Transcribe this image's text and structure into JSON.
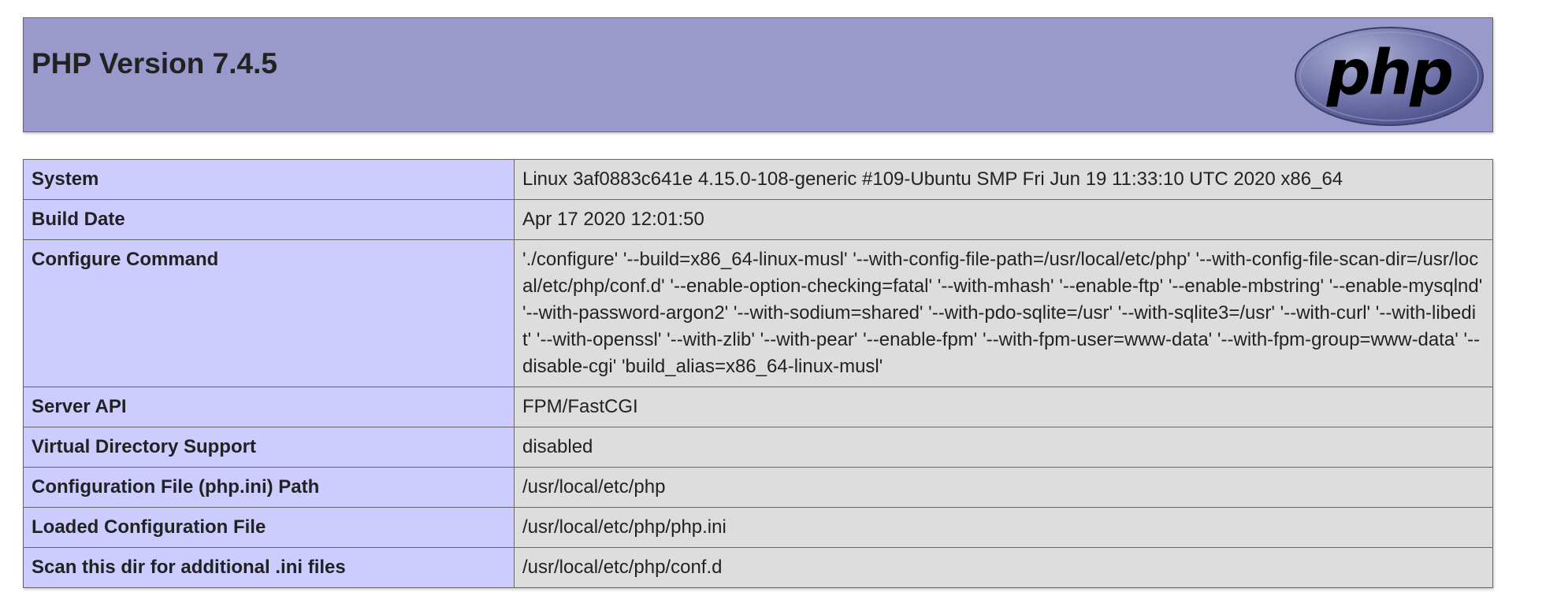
{
  "header": {
    "title": "PHP Version 7.4.5",
    "logo_text": "php"
  },
  "colors": {
    "header_bg": "#9999cc",
    "label_bg": "#ccccff",
    "value_bg": "#dddddd",
    "border": "#666666"
  },
  "rows": [
    {
      "label": "System",
      "value": "Linux 3af0883c641e 4.15.0-108-generic #109-Ubuntu SMP Fri Jun 19 11:33:10 UTC 2020 x86_64"
    },
    {
      "label": "Build Date",
      "value": "Apr 17 2020 12:01:50"
    },
    {
      "label": "Configure Command",
      "value": "'./configure' '--build=x86_64-linux-musl' '--with-config-file-path=/usr/local/etc/php' '--with-config-file-scan-dir=/usr/local/etc/php/conf.d' '--enable-option-checking=fatal' '--with-mhash' '--enable-ftp' '--enable-mbstring' '--enable-mysqlnd' '--with-password-argon2' '--with-sodium=shared' '--with-pdo-sqlite=/usr' '--with-sqlite3=/usr' '--with-curl' '--with-libedit' '--with-openssl' '--with-zlib' '--with-pear' '--enable-fpm' '--with-fpm-user=www-data' '--with-fpm-group=www-data' '--disable-cgi' 'build_alias=x86_64-linux-musl'"
    },
    {
      "label": "Server API",
      "value": "FPM/FastCGI"
    },
    {
      "label": "Virtual Directory Support",
      "value": "disabled"
    },
    {
      "label": "Configuration File (php.ini) Path",
      "value": "/usr/local/etc/php"
    },
    {
      "label": "Loaded Configuration File",
      "value": "/usr/local/etc/php/php.ini"
    },
    {
      "label": "Scan this dir for additional .ini files",
      "value": "/usr/local/etc/php/conf.d"
    }
  ]
}
